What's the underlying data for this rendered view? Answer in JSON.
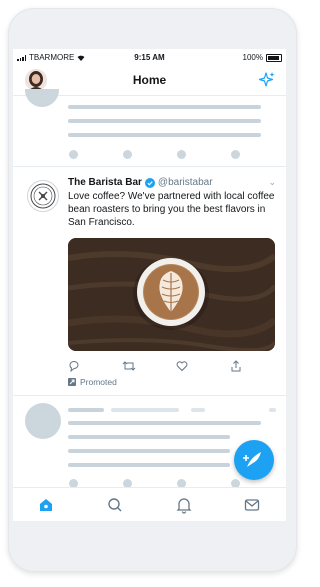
{
  "status_bar": {
    "carrier": "TBARMORE",
    "time": "9:15 AM",
    "battery": "100%"
  },
  "nav": {
    "title": "Home",
    "left_icon": "profile-avatar",
    "right_icon": "sparkle-icon"
  },
  "tweet": {
    "display_name": "The Barista Bar",
    "verified": true,
    "handle": "@baristabar",
    "text": "Love coffee? We've partnered with local coffee bean roasters to bring you the best flavors in San Francisco.",
    "promoted_label": "Promoted",
    "actions": [
      "reply-icon",
      "retweet-icon",
      "like-icon",
      "share-icon"
    ]
  },
  "tab_bar": {
    "tabs": [
      "home-icon",
      "search-icon",
      "notifications-icon",
      "messages-icon"
    ],
    "active_tab": "home-icon"
  },
  "colors": {
    "accent": "#1da1f2",
    "skeleton": "#c9d3dc",
    "text_primary": "#14171a",
    "text_secondary": "#657786"
  }
}
